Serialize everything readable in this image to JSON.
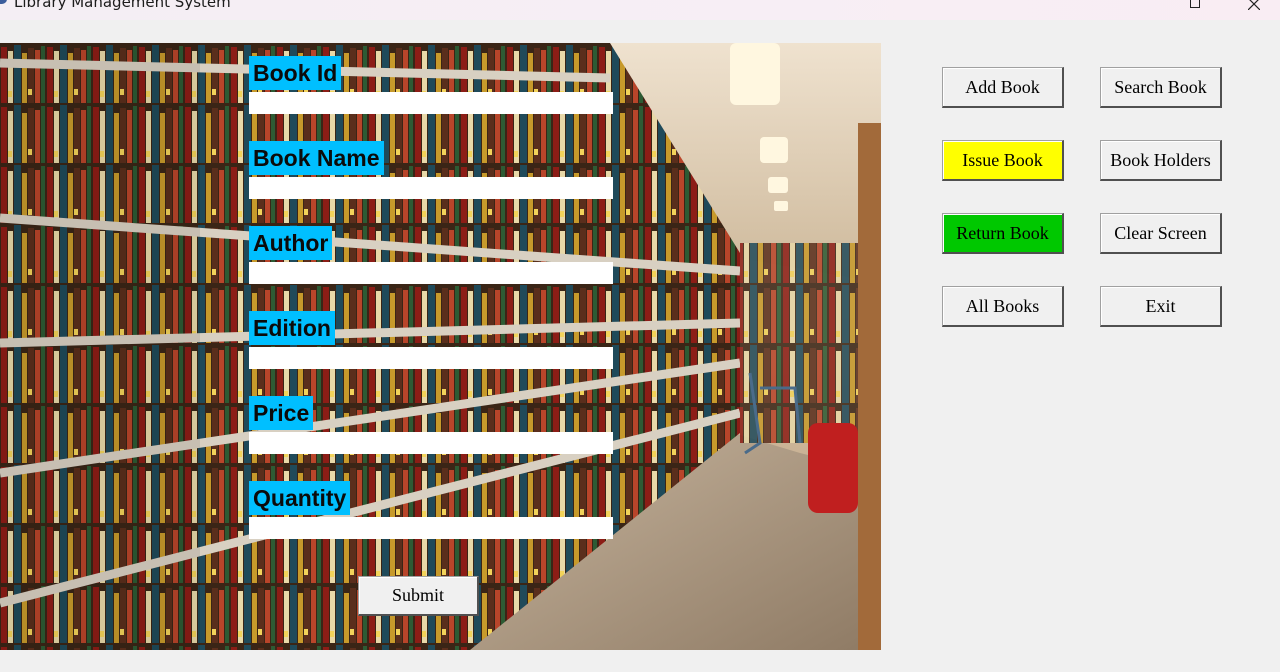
{
  "window": {
    "title": "Library Management System",
    "controls": [
      "restore",
      "close"
    ]
  },
  "form": {
    "fields": [
      {
        "label": "Book Id",
        "value": ""
      },
      {
        "label": "Book Name",
        "value": ""
      },
      {
        "label": "Author",
        "value": ""
      },
      {
        "label": "Edition",
        "value": ""
      },
      {
        "label": "Price",
        "value": ""
      },
      {
        "label": "Quantity",
        "value": ""
      }
    ],
    "submit_label": "Submit",
    "label_bg_color": "#00bfff"
  },
  "actions": {
    "add_book": "Add Book",
    "search_book": "Search Book",
    "issue_book": "Issue Book",
    "book_holders": "Book Holders",
    "return_book": "Return Book",
    "clear_screen": "Clear Screen",
    "all_books": "All Books",
    "exit": "Exit"
  },
  "colors": {
    "issue_book_bg": "#ffff00",
    "return_book_bg": "#00c800"
  },
  "background_image": "library-bookshelves-photo"
}
